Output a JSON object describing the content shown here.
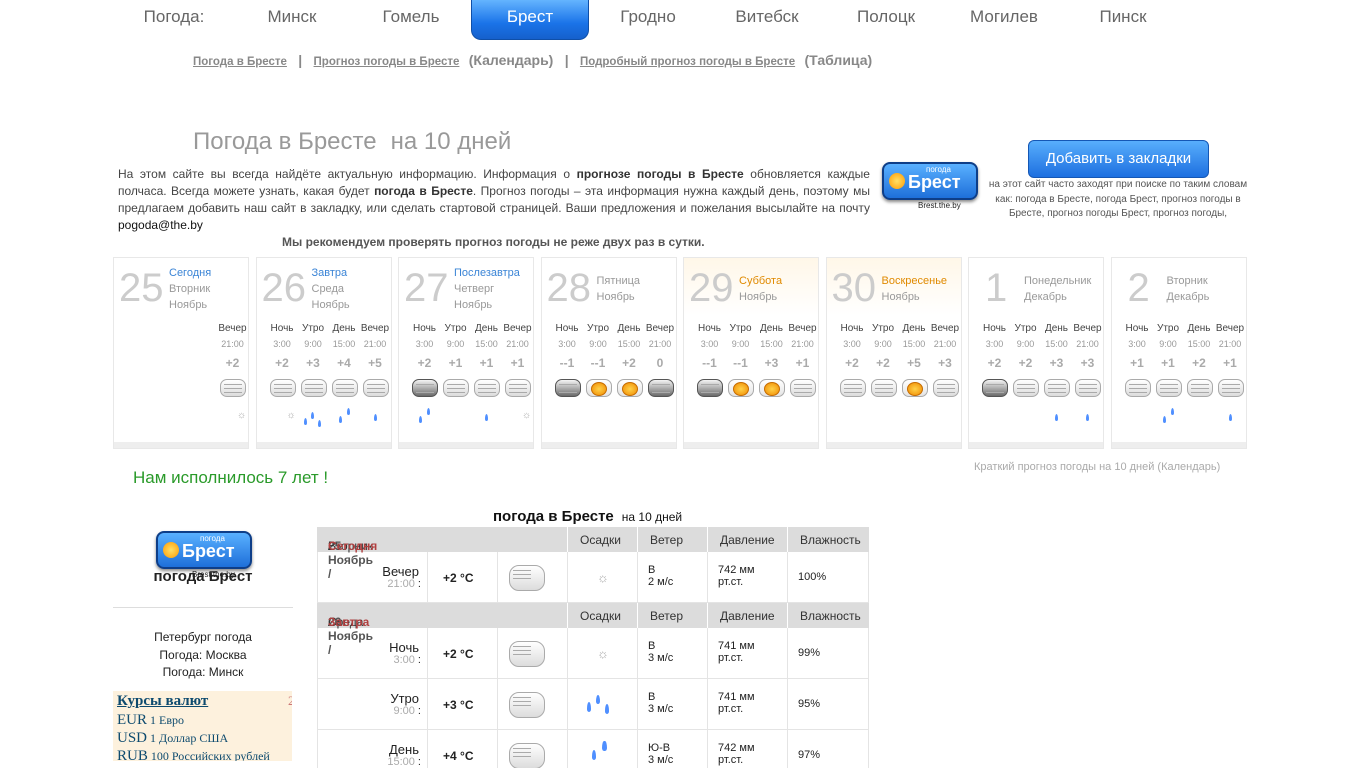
{
  "nav": {
    "cities": [
      "Погода:",
      "Минск",
      "Гомель",
      "Брест",
      "Гродно",
      "Витебск",
      "Полоцк",
      "Могилев",
      "Пинск"
    ],
    "active": "Брест"
  },
  "sublinks": {
    "link1": "Погода в Бресте",
    "link2": "Прогноз погоды в Бресте",
    "calendar": "(Календарь)",
    "link3": "Подробный прогноз погоды в Бресте",
    "table": "(Таблица)",
    "sep": "|"
  },
  "intro": {
    "title": "Погода в Бресте",
    "title_sub": "на 10 дней",
    "p1": "На этом сайте вы всегда найдёте актуальную информацию. Информация о ",
    "b1": "прогнозе погоды в Бресте",
    "p2": " обновляется каждые полчаса. Всегда можете узнать, какая будет ",
    "b2": "погода в Бресте",
    "p3": ". Прогноз погоды – эта информация нужна каждый день, поэтому мы предлагаем добавить наш сайт в закладку, или сделать стартовой страницей. Ваши предложения и пожелания высылайте на почту ",
    "email": "pogoda@the.by",
    "recommend": "Мы рекомендуем проверять прогноз погоды не реже двух раз в сутки."
  },
  "logo": {
    "small": "погода",
    "city": "Брест",
    "site": "Brest.the.by"
  },
  "bookmark": {
    "label": "Добавить в закладки",
    "note": "на этот сайт часто заходят при поиске по таким словам как: погода в Бресте, погода Брест, прогноз погоды в Бресте, прогноз погоды Брест, прогноз погоды,"
  },
  "days": [
    {
      "num": "25",
      "rel": "Сегодня",
      "weekday": "Вторник",
      "month": "Ноябрь",
      "weekend": false,
      "periods": [
        {
          "name": "Вечер",
          "hour": "21:00",
          "temp": "+2",
          "icon": "cloud",
          "prec": "snow"
        }
      ]
    },
    {
      "num": "26",
      "rel": "Завтра",
      "weekday": "Среда",
      "month": "Ноябрь",
      "weekend": false,
      "periods": [
        {
          "name": "Ночь",
          "hour": "3:00",
          "temp": "+2",
          "icon": "cloud",
          "prec": "snow"
        },
        {
          "name": "Утро",
          "hour": "9:00",
          "temp": "+3",
          "icon": "cloud",
          "prec": "rain3"
        },
        {
          "name": "День",
          "hour": "15:00",
          "temp": "+4",
          "icon": "cloud",
          "prec": "rain2"
        },
        {
          "name": "Вечер",
          "hour": "21:00",
          "temp": "+5",
          "icon": "cloud",
          "prec": "rain1"
        }
      ]
    },
    {
      "num": "27",
      "rel": "Послезавтра",
      "weekday": "Четверг",
      "month": "Ноябрь",
      "weekend": false,
      "periods": [
        {
          "name": "Ночь",
          "hour": "3:00",
          "temp": "+2",
          "icon": "dark",
          "prec": "rain2"
        },
        {
          "name": "Утро",
          "hour": "9:00",
          "temp": "+1",
          "icon": "cloud",
          "prec": ""
        },
        {
          "name": "День",
          "hour": "15:00",
          "temp": "+1",
          "icon": "cloud",
          "prec": "rain1"
        },
        {
          "name": "Вечер",
          "hour": "21:00",
          "temp": "+1",
          "icon": "cloud",
          "prec": "snow"
        }
      ]
    },
    {
      "num": "28",
      "rel": "",
      "weekday": "Пятница",
      "month": "Ноябрь",
      "weekend": false,
      "periods": [
        {
          "name": "Ночь",
          "hour": "3:00",
          "temp": "--1",
          "icon": "dark",
          "prec": ""
        },
        {
          "name": "Утро",
          "hour": "9:00",
          "temp": "--1",
          "icon": "sunny",
          "prec": ""
        },
        {
          "name": "День",
          "hour": "15:00",
          "temp": "+2",
          "icon": "sunny",
          "prec": ""
        },
        {
          "name": "Вечер",
          "hour": "21:00",
          "temp": "0",
          "icon": "dark",
          "prec": ""
        }
      ]
    },
    {
      "num": "29",
      "rel": "",
      "weekday": "Суббота",
      "month": "Ноябрь",
      "weekend": true,
      "periods": [
        {
          "name": "Ночь",
          "hour": "3:00",
          "temp": "--1",
          "icon": "dark",
          "prec": ""
        },
        {
          "name": "Утро",
          "hour": "9:00",
          "temp": "--1",
          "icon": "sunny",
          "prec": ""
        },
        {
          "name": "День",
          "hour": "15:00",
          "temp": "+3",
          "icon": "sunny",
          "prec": ""
        },
        {
          "name": "Вечер",
          "hour": "21:00",
          "temp": "+1",
          "icon": "cloud",
          "prec": ""
        }
      ]
    },
    {
      "num": "30",
      "rel": "",
      "weekday": "Воскресенье",
      "month": "Ноябрь",
      "weekend": true,
      "periods": [
        {
          "name": "Ночь",
          "hour": "3:00",
          "temp": "+2",
          "icon": "cloud",
          "prec": ""
        },
        {
          "name": "Утро",
          "hour": "9:00",
          "temp": "+2",
          "icon": "cloud",
          "prec": ""
        },
        {
          "name": "День",
          "hour": "15:00",
          "temp": "+5",
          "icon": "sunny",
          "prec": ""
        },
        {
          "name": "Вечер",
          "hour": "21:00",
          "temp": "+3",
          "icon": "cloud",
          "prec": ""
        }
      ]
    },
    {
      "num": "1",
      "rel": "",
      "weekday": "Понедельник",
      "month": "Декабрь",
      "weekend": false,
      "periods": [
        {
          "name": "Ночь",
          "hour": "3:00",
          "temp": "+2",
          "icon": "dark",
          "prec": ""
        },
        {
          "name": "Утро",
          "hour": "9:00",
          "temp": "+2",
          "icon": "cloud",
          "prec": ""
        },
        {
          "name": "День",
          "hour": "15:00",
          "temp": "+3",
          "icon": "cloud",
          "prec": "rain1"
        },
        {
          "name": "Вечер",
          "hour": "21:00",
          "temp": "+3",
          "icon": "cloud",
          "prec": "rain1"
        }
      ]
    },
    {
      "num": "2",
      "rel": "",
      "weekday": "Вторник",
      "month": "Декабрь",
      "weekend": false,
      "periods": [
        {
          "name": "Ночь",
          "hour": "3:00",
          "temp": "+1",
          "icon": "cloud",
          "prec": ""
        },
        {
          "name": "Утро",
          "hour": "9:00",
          "temp": "+1",
          "icon": "cloud",
          "prec": "rain2"
        },
        {
          "name": "День",
          "hour": "15:00",
          "temp": "+2",
          "icon": "cloud",
          "prec": ""
        },
        {
          "name": "Вечер",
          "hour": "21:00",
          "temp": "+1",
          "icon": "cloud",
          "prec": "rain1"
        }
      ]
    }
  ],
  "birthday": "Нам исполнилось 7 лет !",
  "calendar_note": "Краткий прогноз погоды на 10 дней (Календарь)",
  "side": {
    "title": "погода Брест",
    "links": [
      "Петербург погода",
      "Погода: Москва",
      "Погода: Минск"
    ]
  },
  "rates": {
    "title": "Курсы валют",
    "digit": "2",
    "rows": [
      {
        "code": "EUR",
        "name": "1 Евро"
      },
      {
        "code": "USD",
        "name": "1 Доллар США"
      },
      {
        "code": "RUB",
        "name": "100 Российских рублей"
      }
    ]
  },
  "table": {
    "title": "погода в Бресте",
    "title_sub": "на 10 дней",
    "headers": {
      "precip": "Осадки",
      "wind": "Ветер",
      "pressure": "Давление",
      "humidity": "Влажность"
    },
    "sections": [
      {
        "date": "25 Ноябрь /",
        "weekday": "Вторник",
        "rel": "Сегодня",
        "rows": [
          {
            "period": "Вечер",
            "hour": "21:00",
            "temp": "+2 °C",
            "prec": "snow",
            "wind_dir": "В",
            "wind_speed": "2 м/с",
            "pressure": "742 мм",
            "pressure_unit": "рт.ст.",
            "humidity": "100%"
          }
        ]
      },
      {
        "date": "26 Ноябрь /",
        "weekday": "Среда",
        "rel": "Завтра",
        "rows": [
          {
            "period": "Ночь",
            "hour": "3:00",
            "temp": "+2 °C",
            "prec": "snow",
            "wind_dir": "В",
            "wind_speed": "3 м/с",
            "pressure": "741 мм",
            "pressure_unit": "рт.ст.",
            "humidity": "99%"
          },
          {
            "period": "Утро",
            "hour": "9:00",
            "temp": "+3 °C",
            "prec": "rain3",
            "wind_dir": "В",
            "wind_speed": "3 м/с",
            "pressure": "741 мм",
            "pressure_unit": "рт.ст.",
            "humidity": "95%"
          },
          {
            "period": "День",
            "hour": "15:00",
            "temp": "+4 °C",
            "prec": "rain2",
            "wind_dir": "Ю-В",
            "wind_speed": "3 м/с",
            "pressure": "742 мм",
            "pressure_unit": "рт.ст.",
            "humidity": "97%"
          }
        ]
      }
    ]
  }
}
